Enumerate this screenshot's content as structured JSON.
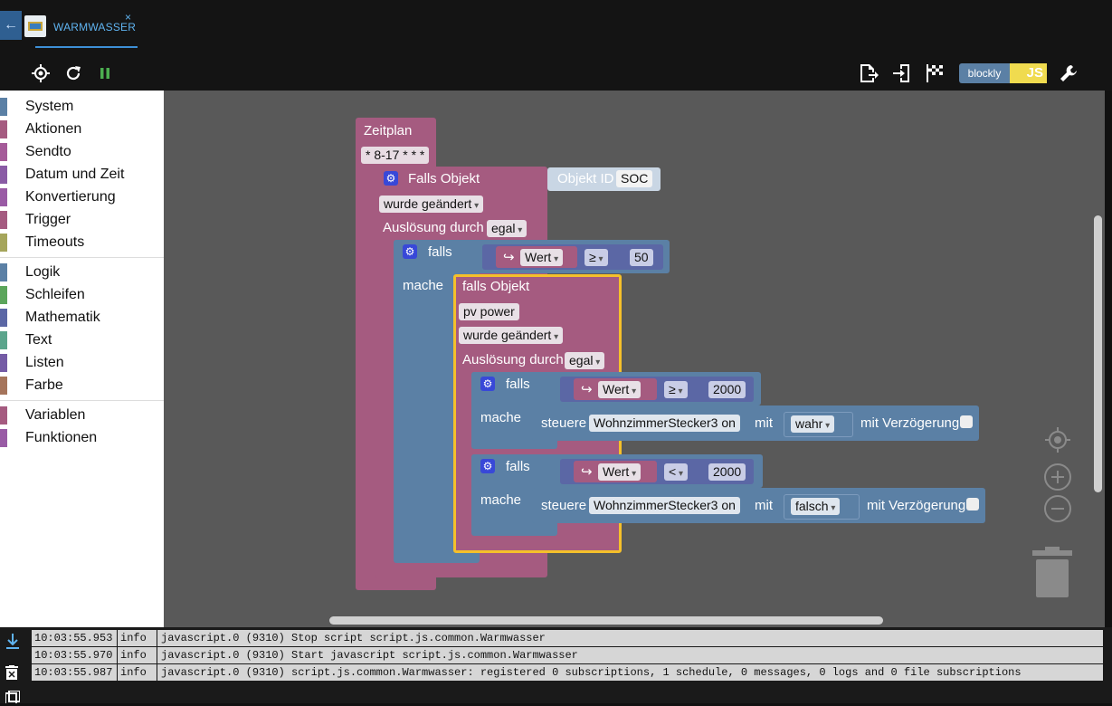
{
  "tab": {
    "back": "←",
    "label": "WARMWASSER",
    "close": "×"
  },
  "toolbar": {
    "icons": [
      "target-icon",
      "refresh-icon",
      "pause-icon",
      "export-icon",
      "import-icon",
      "flag-icon",
      "wrench-icon"
    ],
    "blockly_label": "blockly",
    "js_label": "JS"
  },
  "toolbox": {
    "groups": [
      [
        {
          "label": "System",
          "color": "#5b80a5"
        },
        {
          "label": "Aktionen",
          "color": "#a55b80"
        },
        {
          "label": "Sendto",
          "color": "#a55b99"
        },
        {
          "label": "Datum und Zeit",
          "color": "#8a5ba5"
        },
        {
          "label": "Konvertierung",
          "color": "#9a5ba5"
        },
        {
          "label": "Trigger",
          "color": "#a55b80"
        },
        {
          "label": "Timeouts",
          "color": "#a5a55b"
        }
      ],
      [
        {
          "label": "Logik",
          "color": "#5b80a5"
        },
        {
          "label": "Schleifen",
          "color": "#5ba55b"
        },
        {
          "label": "Mathematik",
          "color": "#5b67a5"
        },
        {
          "label": "Text",
          "color": "#5ba58c"
        },
        {
          "label": "Listen",
          "color": "#745ba5"
        },
        {
          "label": "Farbe",
          "color": "#a5745b"
        }
      ],
      [
        {
          "label": "Variablen",
          "color": "#a55b80"
        },
        {
          "label": "Funktionen",
          "color": "#995ba5"
        }
      ]
    ]
  },
  "blocks": {
    "schedule_label": "Zeitplan",
    "schedule_value": "* 8-17 * * *",
    "trigger1": {
      "label": "Falls Objekt",
      "object_id_label": "Objekt ID",
      "object_id_value": "SOC",
      "condition": "wurde geändert",
      "ack_label": "Auslösung durch",
      "ack_value": "egal"
    },
    "if1": {
      "label": "falls",
      "do_label": "mache",
      "var": "Wert",
      "op": "≥",
      "value": "50"
    },
    "trigger2": {
      "label": "falls Objekt",
      "object_value": "pv power",
      "condition": "wurde geändert",
      "ack_label": "Auslösung durch",
      "ack_value": "egal"
    },
    "if2": {
      "label": "falls",
      "do_label": "mache",
      "var": "Wert",
      "op": "≥",
      "value": "2000",
      "control_label": "steuere",
      "device": "WohnzimmerStecker3 on",
      "with_label": "mit",
      "state": "wahr",
      "delay_label": "mit Verzögerung"
    },
    "if3": {
      "label": "falls",
      "do_label": "mache",
      "var": "Wert",
      "op": "<",
      "value": "2000",
      "control_label": "steuere",
      "device": "WohnzimmerStecker3 on",
      "with_label": "mit",
      "state": "falsch",
      "delay_label": "mit Verzögerung"
    }
  },
  "log": [
    {
      "time": "10:03:55.953",
      "level": "info",
      "msg": "javascript.0 (9310) Stop script script.js.common.Warmwasser"
    },
    {
      "time": "10:03:55.970",
      "level": "info",
      "msg": "javascript.0 (9310) Start javascript script.js.common.Warmwasser"
    },
    {
      "time": "10:03:55.987",
      "level": "info",
      "msg": "javascript.0 (9310) script.js.common.Warmwasser: registered 0 subscriptions, 1 schedule, 0 messages, 0 logs and 0 file subscriptions"
    }
  ]
}
